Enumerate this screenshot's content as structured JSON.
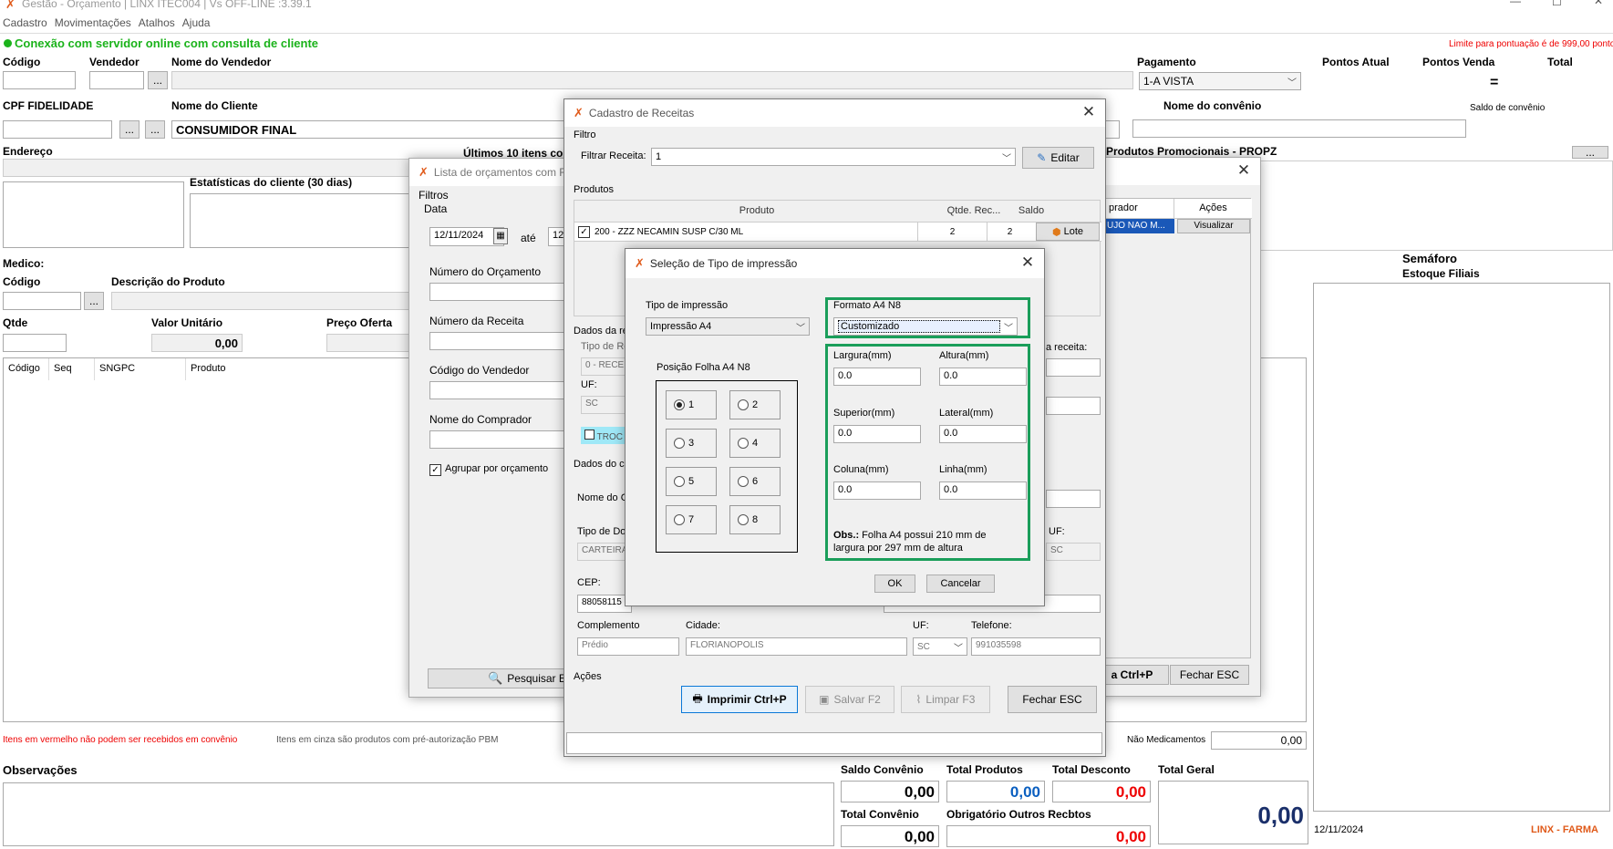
{
  "app": {
    "title": "Gestão - Orçamento | LINX ITEC004 | Vs OFF-LINE :3.39.1",
    "menu": [
      "Cadastro",
      "Movimentações",
      "Atalhos",
      "Ajuda"
    ],
    "connection_status": "Conexão com servidor online com consulta de cliente",
    "limit_note": "Limite para pontuação é de 999,00 pontos"
  },
  "main": {
    "codigo_label": "Código",
    "vendedor_label": "Vendedor",
    "nome_vendedor_label": "Nome do Vendedor",
    "pagamento_label": "Pagamento",
    "pagamento_value": "1-A VISTA",
    "pontos_atual_label": "Pontos Atual",
    "pontos_venda_label": "Pontos Venda",
    "total_label": "Total",
    "equals": "=",
    "cpf_label": "CPF FIDELIDADE",
    "nome_cliente_label": "Nome do Cliente",
    "nome_cliente_value": "CONSUMIDOR FINAL",
    "nome_convenio_label": "Nome do convênio",
    "saldo_convenio_label": "Saldo de convênio",
    "endereco_label": "Endereço",
    "ultimos_label": "Últimos 10 itens com",
    "produtos_promo_label": "Produtos Promocionais - PROPZ",
    "estatisticas_label": "Estatísticas do cliente (30 dias)",
    "medico_label": "Medico:",
    "codigo2_label": "Código",
    "descricao_label": "Descrição do Produto",
    "semaforo_label": "Semáforo",
    "estoque_label": "Estoque Filiais",
    "qtde_label": "Qtde",
    "valor_unitario_label": "Valor Unitário",
    "valor_unitario_value": "0,00",
    "preco_oferta_label": "Preço Oferta",
    "table_headers": [
      "Código",
      "Seq",
      "SNGPC",
      "Produto"
    ],
    "red_note": "Itens em vermelho não podem ser recebidos em convênio",
    "gray_note": "Itens em cinza são produtos com pré-autorização PBM",
    "nao_medicamentos_label": "Não Medicamentos",
    "nao_medicamentos_value": "0,00",
    "observacoes_label": "Observações",
    "saldo_convenio2_label": "Saldo Convênio",
    "saldo_convenio2_value": "0,00",
    "total_produtos_label": "Total Produtos",
    "total_produtos_value": "0,00",
    "total_desconto_label": "Total Desconto",
    "total_desconto_value": "0,00",
    "total_geral_label": "Total Geral",
    "total_geral_value": "0,00",
    "total_convenio_label": "Total Convênio",
    "total_convenio_value": "0,00",
    "obrigatorio_label": "Obrigatório Outros Recbtos",
    "obrigatorio_value": "0,00",
    "date": "12/11/2024",
    "brand": "LINX - FARMA",
    "ellipsis": "...",
    "gridwin_headers": [
      "prador",
      "Ações"
    ],
    "gridwin_row_cell": "UJO NAO M...",
    "gridwin_visualizar": "Visualizar",
    "gridwin_print_tail": "a Ctrl+P",
    "gridwin_fechar": "Fechar ESC"
  },
  "lista_window": {
    "title": "Lista de orçamentos com R",
    "filtros_label": "Filtros",
    "data_label": "Data",
    "date_from": "12/11/2024",
    "ate_label": "até",
    "date_to": "12/",
    "numero_orcamento_label": "Número do Orçamento",
    "numero_receita_label": "Número da Receita",
    "codigo_vendedor_label": "Código do Vendedor",
    "nome_comprador_label": "Nome do Comprador",
    "agrupar_label": "Agrupar por orçamento",
    "pesquisar_label": "Pesquisar ENT"
  },
  "cadastro_window": {
    "title": "Cadastro de Receitas",
    "filtro_label": "Filtro",
    "filtrar_label": "Filtrar Receita:",
    "filtrar_value": "1",
    "editar_label": "Editar",
    "produtos_label": "Produtos",
    "headers": [
      "Produto",
      "Qtde. Rec...",
      "Saldo"
    ],
    "row": {
      "produto": "200 - ZZZ NECAMIN SUSP C/30 ML",
      "qtde": "2",
      "saldo": "2",
      "lote": "Lote"
    },
    "dados_re_label": "Dados da re",
    "tipo_de_r_label": "Tipo de Re",
    "tipo_value": "0 - RECE",
    "uf_label": "UF:",
    "uf_value": "SC",
    "troc_label": "TROC",
    "receita_label": "a receita:",
    "dados_co_label": "Dados do co",
    "nome_c_label": "Nome do C",
    "tipo_doc_label": "Tipo de Doc",
    "tipo_doc_value": "CARTEIRA",
    "uf2_label": "UF:",
    "uf2_value": "SC",
    "cep_label": "CEP:",
    "cep_value": "88058115",
    "complemento_label": "Complemento",
    "complemento_value": "Prédio",
    "cidade_label": "Cidade:",
    "cidade_value": "FLORIANOPOLIS",
    "uf3_label": "UF:",
    "uf3_value": "SC",
    "telefone_label": "Telefone:",
    "telefone_value": "991035598",
    "acoes_label": "Ações",
    "imprimir_label": "Imprimir Ctrl+P",
    "salvar_label": "Salvar F2",
    "limpar_label": "Limpar F3",
    "fechar_label": "Fechar ESC"
  },
  "dialog": {
    "title": "Seleção de Tipo de impressão",
    "tipo_label": "Tipo de impressão",
    "tipo_value": "Impressão A4",
    "posicao_label": "Posição Folha A4 N8",
    "positions": [
      "1",
      "2",
      "3",
      "4",
      "5",
      "6",
      "7",
      "8"
    ],
    "formato_label": "Formato A4 N8",
    "formato_value": "Customizado",
    "largura_label": "Largura(mm)",
    "largura_value": "0.0",
    "altura_label": "Altura(mm)",
    "altura_value": "0.0",
    "superior_label": "Superior(mm)",
    "superior_value": "0.0",
    "lateral_label": "Lateral(mm)",
    "lateral_value": "0.0",
    "coluna_label": "Coluna(mm)",
    "coluna_value": "0.0",
    "linha_label": "Linha(mm)",
    "linha_value": "0.0",
    "obs_bold": "Obs.:",
    "obs_line1": " Folha A4 possui 210 mm de",
    "obs_line2": "largura por 297 mm de altura",
    "ok_label": "OK",
    "cancelar_label": "Cancelar",
    "accent": "#1a9e5a"
  }
}
